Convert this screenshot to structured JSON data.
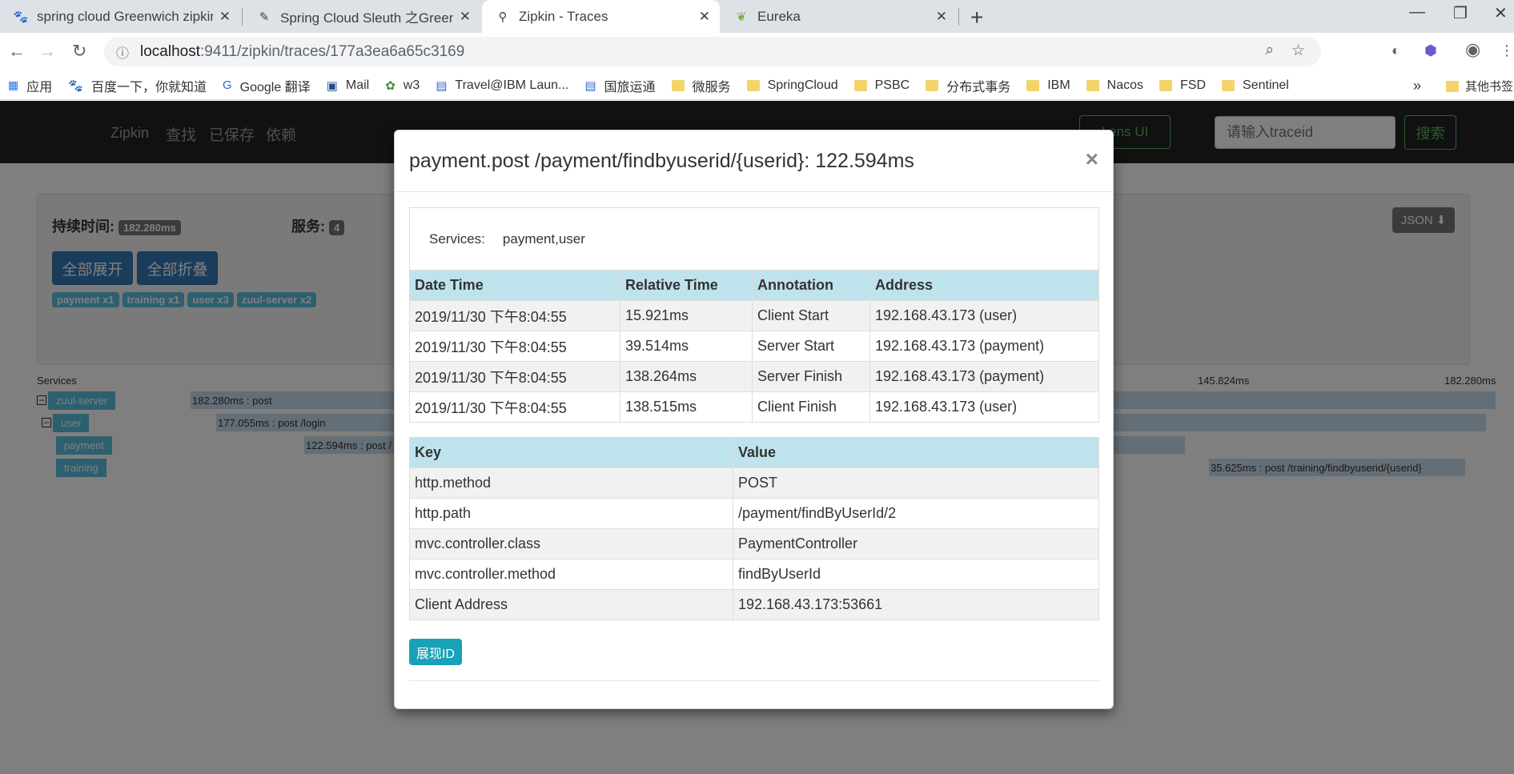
{
  "browser": {
    "tabs": [
      {
        "title": "spring cloud Greenwich zipkin",
        "icon": "paw-icon"
      },
      {
        "title": "Spring Cloud Sleuth 之Greenw",
        "icon": "sleuth-icon"
      },
      {
        "title": "Zipkin - Traces",
        "icon": "zipkin-icon"
      },
      {
        "title": "Eureka",
        "icon": "leaf-icon"
      }
    ],
    "url_host": "localhost",
    "url_path": ":9411/zipkin/traces/177a3ea6a65c3169",
    "bookmarks": [
      "应用",
      "百度一下，你就知道",
      "Google 翻译",
      "Mail",
      "w3",
      "Travel@IBM Laun...",
      "国旅运通",
      "微服务",
      "SpringCloud",
      "PSBC",
      "分布式事务",
      "IBM",
      "Nacos",
      "FSD",
      "Sentinel"
    ],
    "bookmarks_other": "其他书签"
  },
  "zipkin": {
    "brand": "Zipkin",
    "nav": [
      "查找",
      "已保存",
      "依赖"
    ],
    "lens_button": "Lens UI",
    "search_placeholder": "请输入traceid",
    "search_button": "搜索",
    "duration_label": "持续时间:",
    "duration_value": "182.280ms",
    "services_label": "服务:",
    "services_count": "4",
    "expand_all": "全部展开",
    "collapse_all": "全部折叠",
    "json_button": "JSON",
    "service_tags": [
      "payment x1",
      "training x1",
      "user x3",
      "zuul-server x2"
    ],
    "timeline": {
      "header_services": "Services",
      "tick_1": "145.824ms",
      "tick_2": "182.280ms",
      "rows": [
        {
          "name": "zuul-server",
          "span": "182.280ms : post"
        },
        {
          "name": "user",
          "span": "177.055ms : post /login"
        },
        {
          "name": "payment",
          "span": "122.594ms : post /"
        },
        {
          "name": "training",
          "span": "35.625ms : post /training/findbyuserid/{userid}"
        }
      ]
    }
  },
  "modal": {
    "title": "payment.post /payment/findbyuserid/{userid}: 122.594ms",
    "services_label": "Services:",
    "services_value": "payment,user",
    "annotation_headers": [
      "Date Time",
      "Relative Time",
      "Annotation",
      "Address"
    ],
    "annotations": [
      [
        "2019/11/30 下午8:04:55",
        "15.921ms",
        "Client Start",
        "192.168.43.173 (user)"
      ],
      [
        "2019/11/30 下午8:04:55",
        "39.514ms",
        "Server Start",
        "192.168.43.173 (payment)"
      ],
      [
        "2019/11/30 下午8:04:55",
        "138.264ms",
        "Server Finish",
        "192.168.43.173 (payment)"
      ],
      [
        "2019/11/30 下午8:04:55",
        "138.515ms",
        "Client Finish",
        "192.168.43.173 (user)"
      ]
    ],
    "tag_headers": [
      "Key",
      "Value"
    ],
    "tags": [
      [
        "http.method",
        "POST"
      ],
      [
        "http.path",
        "/payment/findByUserId/2"
      ],
      [
        "mvc.controller.class",
        "PaymentController"
      ],
      [
        "mvc.controller.method",
        "findByUserId"
      ],
      [
        "Client Address",
        "192.168.43.173:53661"
      ]
    ],
    "show_id_button": "展现ID"
  }
}
